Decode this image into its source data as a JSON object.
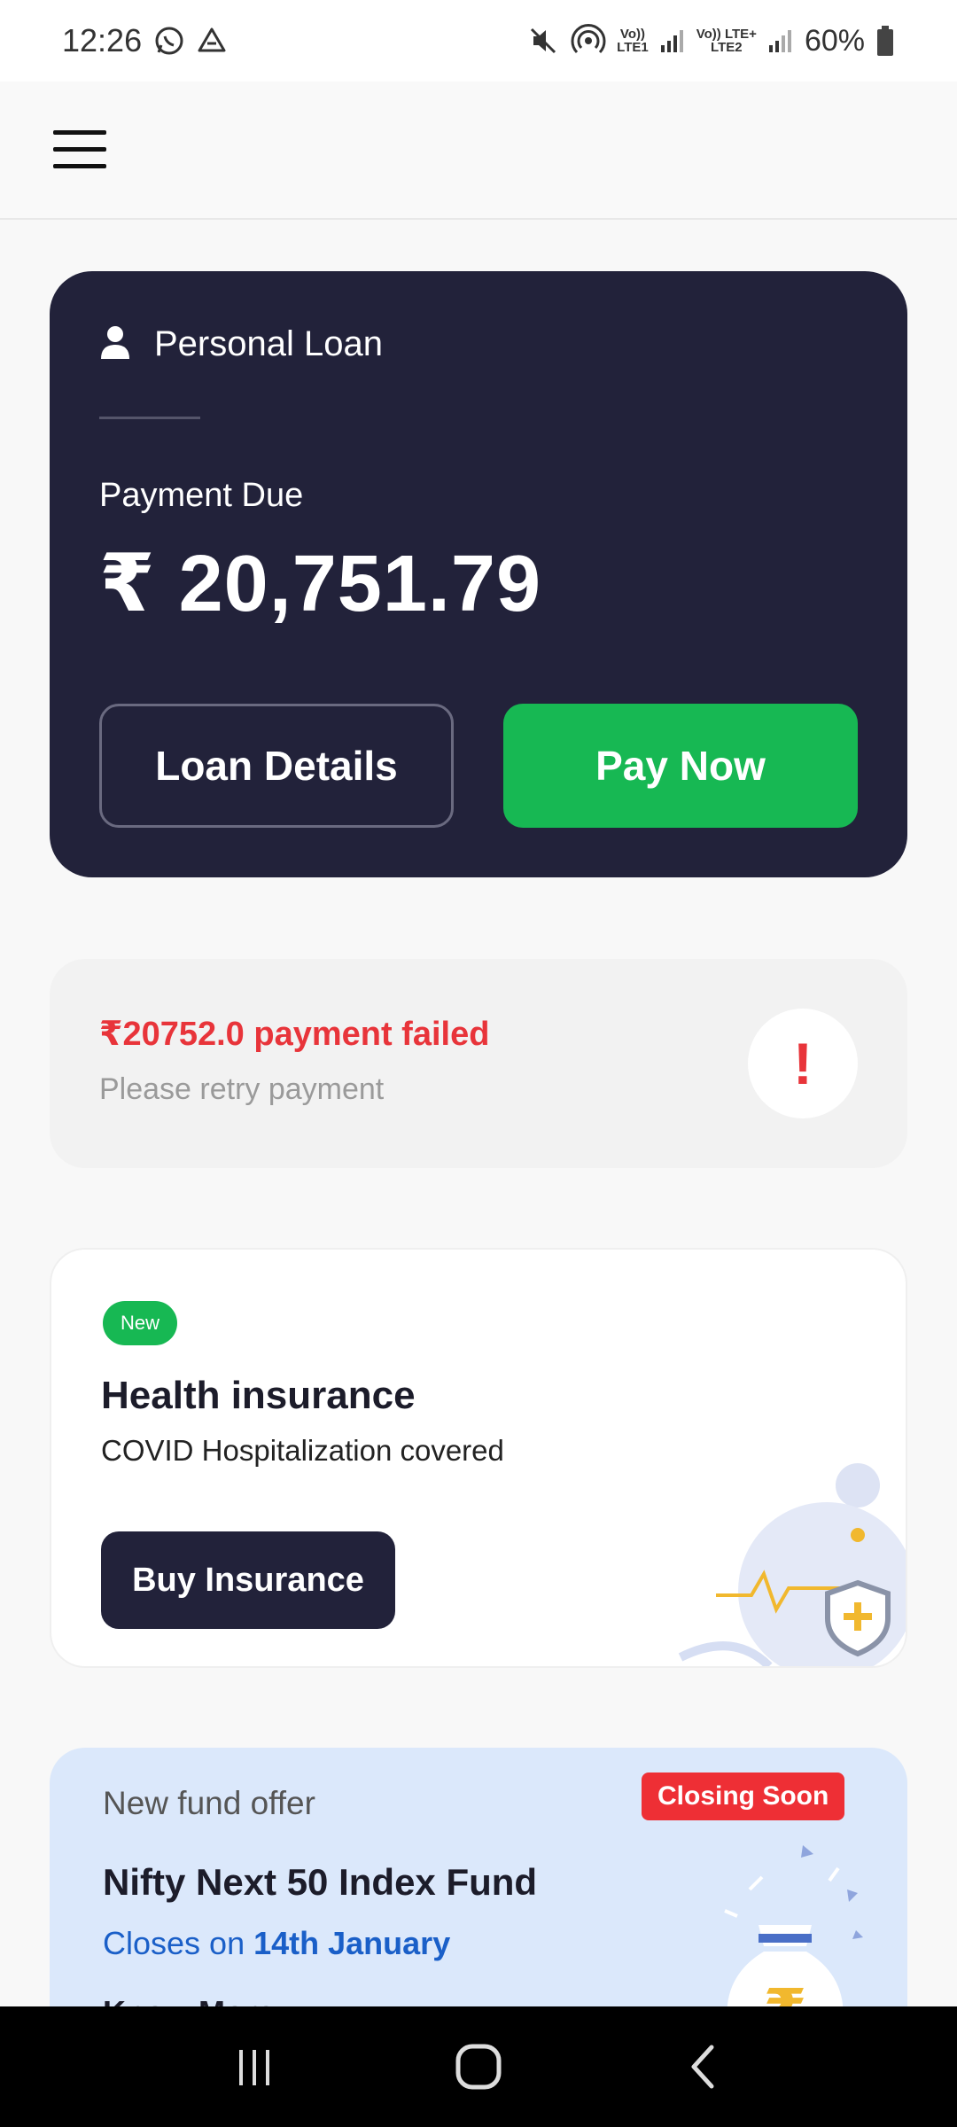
{
  "status_bar": {
    "time": "12:26",
    "battery": "60%",
    "sim1_top": "Vo))",
    "sim1_bottom": "LTE1",
    "sim2_top": "Vo)) LTE+",
    "sim2_bottom": "LTE2"
  },
  "loan_card": {
    "title": "Personal Loan",
    "due_label": "Payment Due",
    "due_amount": "₹ 20,751.79",
    "details_button": "Loan Details",
    "pay_button": "Pay Now"
  },
  "payment_alert": {
    "title": "₹20752.0 payment failed",
    "subtitle": "Please retry payment",
    "icon_text": "!"
  },
  "insurance_card": {
    "badge": "New",
    "title": "Health insurance",
    "subtitle": "COVID Hospitalization covered",
    "button": "Buy Insurance"
  },
  "fund_card": {
    "label": "New fund offer",
    "badge": "Closing Soon",
    "title": "Nifty Next 50 Index Fund",
    "closes_prefix": "Closes on",
    "closes_date": "14th January",
    "link": "Know More ›"
  },
  "colors": {
    "dark_navy": "#22223a",
    "green": "#17b853",
    "red": "#e8343a",
    "fund_bg": "#dbe8fb"
  }
}
